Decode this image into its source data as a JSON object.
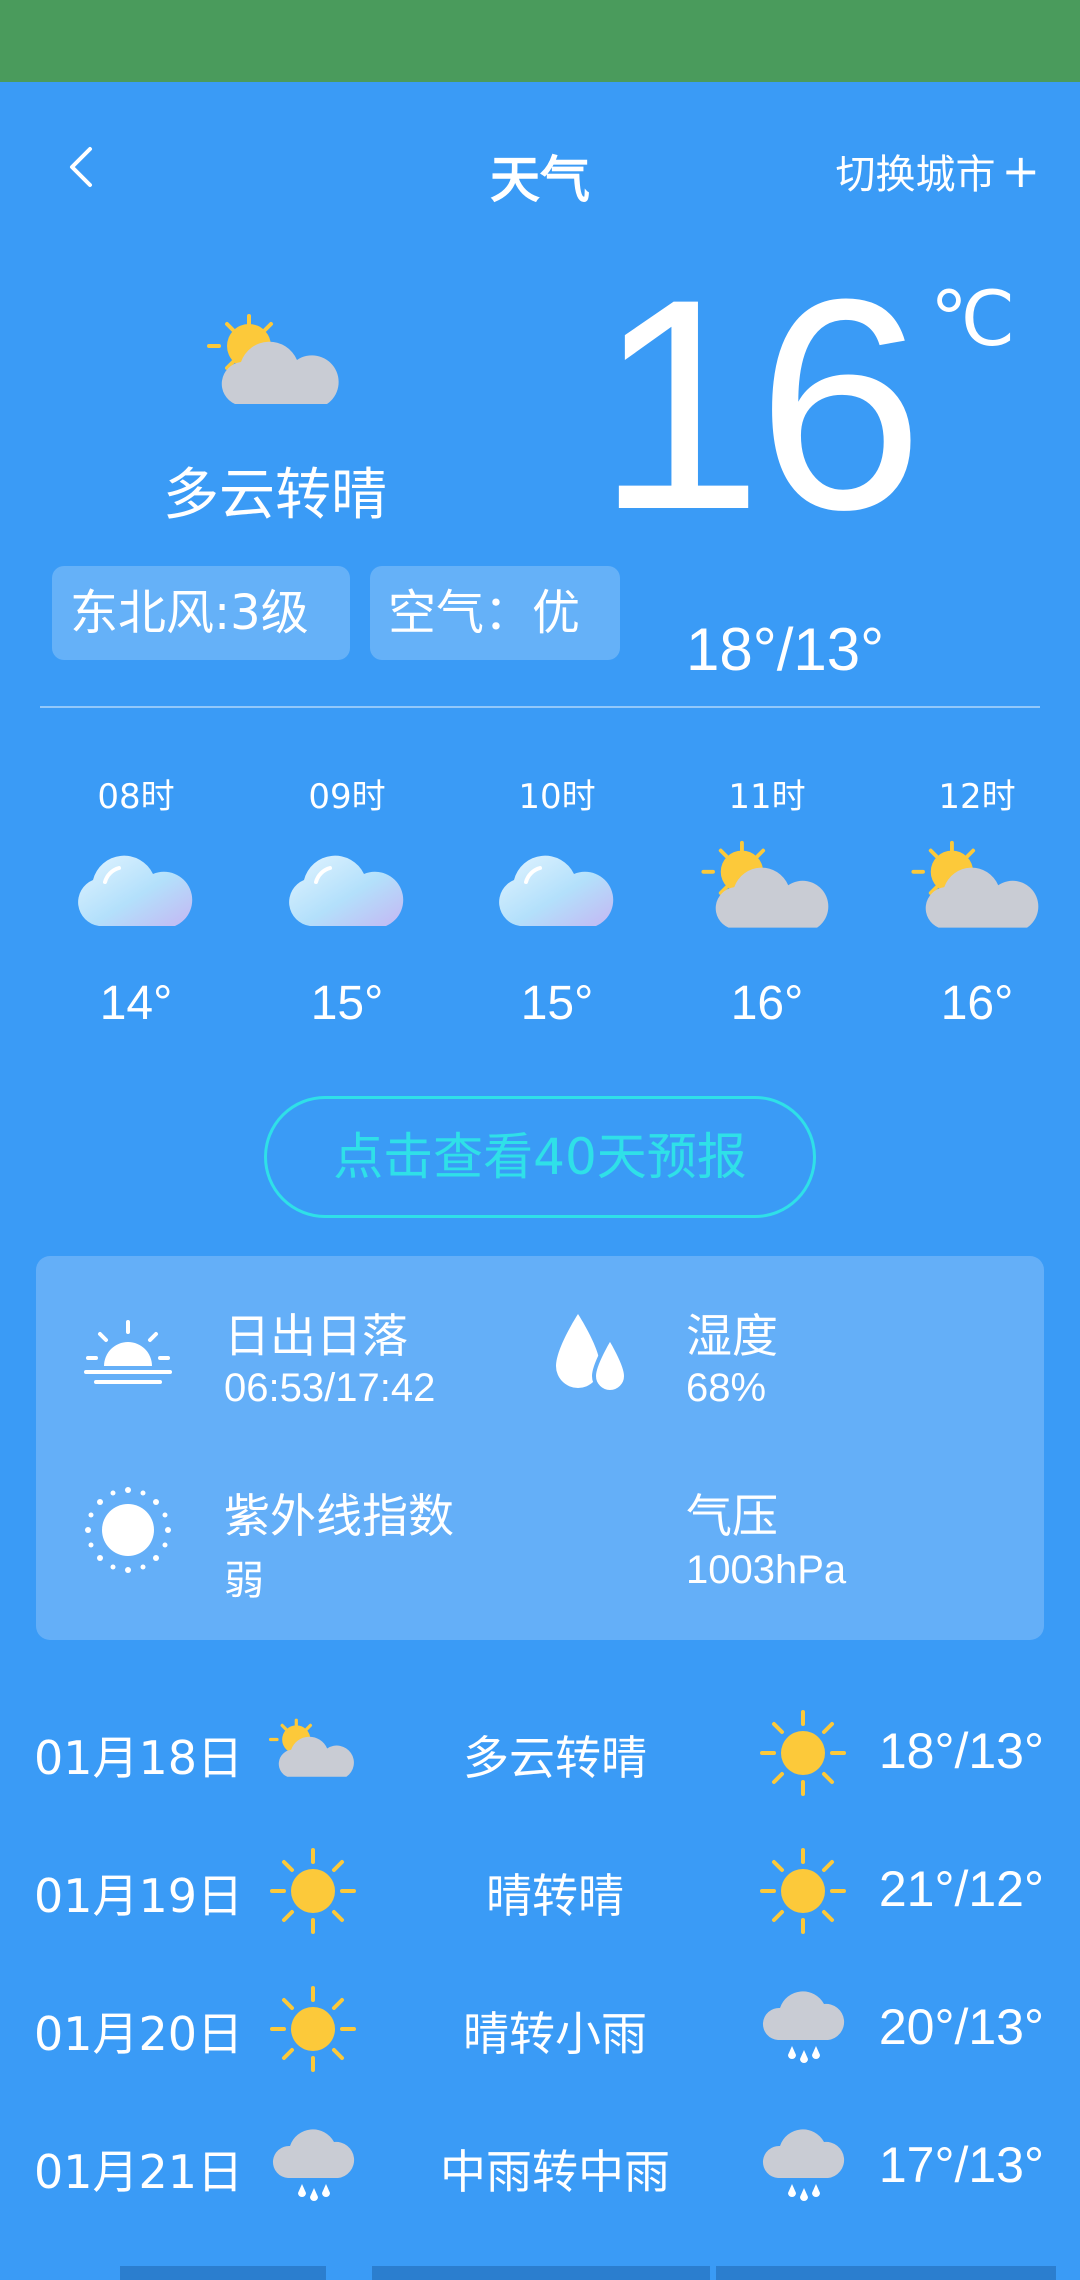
{
  "header": {
    "title": "天气",
    "switch_city": "切换城市"
  },
  "current": {
    "condition": "多云转晴",
    "wind": "东北风:3级",
    "air": "空气：优",
    "temp": "16",
    "unit": "℃",
    "range": "18°/13°",
    "icon": "partly-cloudy-icon"
  },
  "hourly": [
    {
      "time": "08时",
      "temp": "14°",
      "icon": "cloudy-icon"
    },
    {
      "time": "09时",
      "temp": "15°",
      "icon": "cloudy-icon"
    },
    {
      "time": "10时",
      "temp": "15°",
      "icon": "cloudy-icon"
    },
    {
      "time": "11时",
      "temp": "16°",
      "icon": "partly-cloudy-icon"
    },
    {
      "time": "12时",
      "temp": "16°",
      "icon": "partly-cloudy-icon"
    }
  ],
  "forecast_button": "点击查看40天预报",
  "details": {
    "sunrise_label": "日出日落",
    "sunrise_value": "06:53/17:42",
    "humidity_label": "湿度",
    "humidity_value": "68%",
    "uv_label": "紫外线指数",
    "uv_value": "弱",
    "pressure_label": "气压",
    "pressure_value": "1003hPa"
  },
  "daily": [
    {
      "date": "01月18日",
      "icon_day": "partly-cloudy-icon",
      "condition": "多云转晴",
      "icon_night": "sunny-icon",
      "range": "18°/13°"
    },
    {
      "date": "01月19日",
      "icon_day": "sunny-icon",
      "condition": "晴转晴",
      "icon_night": "sunny-icon",
      "range": "21°/12°"
    },
    {
      "date": "01月20日",
      "icon_day": "sunny-icon",
      "condition": "晴转小雨",
      "icon_night": "rain-icon",
      "range": "20°/13°"
    },
    {
      "date": "01月21日",
      "icon_day": "rain-icon",
      "condition": "中雨转中雨",
      "icon_night": "rain-icon",
      "range": "17°/13°"
    }
  ],
  "colors": {
    "status_bar": "#4a9b5c",
    "background": "#3a9bf6",
    "card": "#64aff8",
    "button_accent": "#2fe0e8",
    "sun": "#fcc93a"
  }
}
